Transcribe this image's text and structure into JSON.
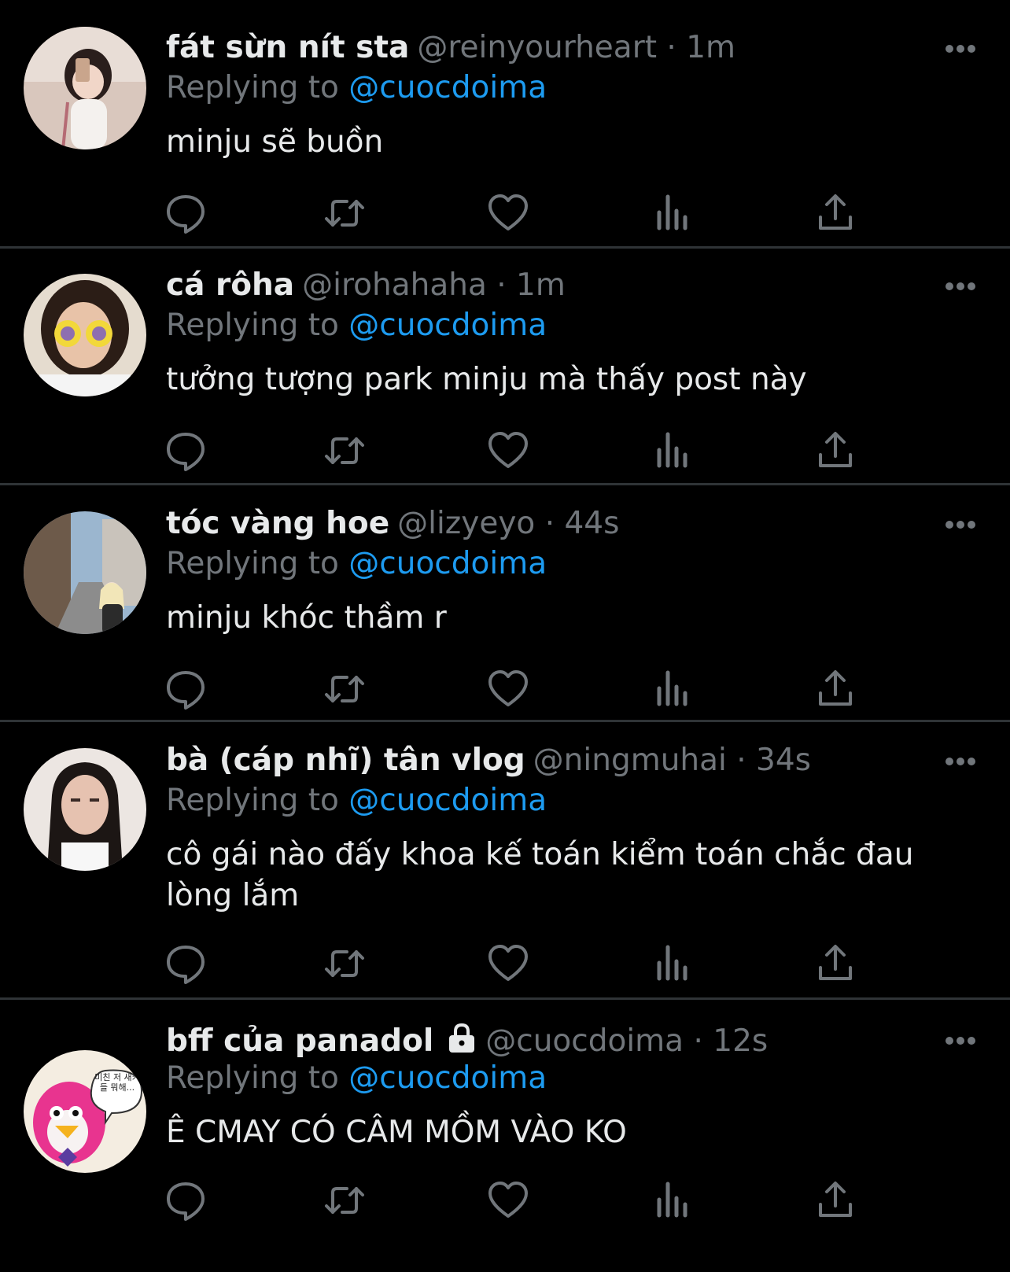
{
  "colors": {
    "background": "#000000",
    "text": "#e7e9ea",
    "muted": "#71767b",
    "link": "#1d9bf0",
    "divider": "#2f3336"
  },
  "reply_prefix": "Replying to",
  "tweets": [
    {
      "name": "fát sừn nít sta",
      "handle": "@reinyourheart",
      "time": "1m",
      "meta": "@reinyourheart · 1m",
      "replying_to": "@cuocdoima",
      "text": "minju sẽ buồn",
      "avatar": "avatar-photo"
    },
    {
      "name": "cá rôha",
      "handle": "@irohahaha",
      "time": "1m",
      "meta": "@irohahaha · 1m",
      "replying_to": "@cuocdoima",
      "text": "tưởng tượng park minju mà thấy post này",
      "avatar": "avatar-photo"
    },
    {
      "name": "tóc vàng hoe",
      "handle": "@lizyeyo",
      "time": "44s",
      "meta": "@lizyeyo · 44s",
      "replying_to": "@cuocdoima",
      "text": "minju khóc thầm r",
      "avatar": "avatar-photo"
    },
    {
      "name": "bà (cáp nhĩ) tân vlog",
      "handle": "@ningmuhai",
      "time": "34s",
      "meta": "@ningmuhai · 34s",
      "replying_to": "@cuocdoima",
      "text": "cô gái nào đấy khoa kế toán kiểm toán chắc đau lòng lắm",
      "avatar": "avatar-photo"
    },
    {
      "name": "bff của panadol",
      "handle": "@cuocdoima",
      "time": "12s",
      "meta": "@cuocdoima · 12s",
      "replying_to": "@cuocdoima",
      "text": "Ê CMAY CÓ CÂM MỒM VÀO KO",
      "avatar": "avatar-cartoon",
      "protected": true,
      "avatar_caption": "미친 저 새키들 뭐해..."
    }
  ],
  "actions": [
    "reply-icon",
    "retweet-icon",
    "like-icon",
    "views-icon",
    "share-icon"
  ]
}
